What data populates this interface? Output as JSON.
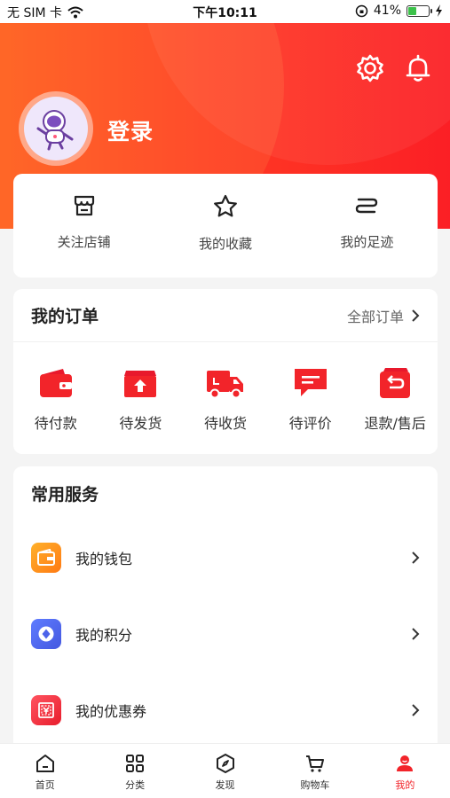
{
  "status_bar": {
    "carrier": "无 SIM 卡",
    "time": "下午10:11",
    "battery": "41%",
    "battery_level": 0.41
  },
  "header": {
    "login_label": "登录"
  },
  "quick_links": [
    {
      "label": "关注店铺",
      "icon": "store-icon"
    },
    {
      "label": "我的收藏",
      "icon": "star-icon"
    },
    {
      "label": "我的足迹",
      "icon": "footprint-icon"
    }
  ],
  "orders": {
    "title": "我的订单",
    "all_label": "全部订单",
    "items": [
      {
        "label": "待付款",
        "icon": "wallet-icon"
      },
      {
        "label": "待发货",
        "icon": "box-icon"
      },
      {
        "label": "待收货",
        "icon": "truck-icon"
      },
      {
        "label": "待评价",
        "icon": "comment-icon"
      },
      {
        "label": "退款/售后",
        "icon": "refund-icon"
      }
    ]
  },
  "services": {
    "title": "常用服务",
    "items": [
      {
        "label": "我的钱包",
        "icon": "wallet-icon"
      },
      {
        "label": "我的积分",
        "icon": "points-icon"
      },
      {
        "label": "我的优惠券",
        "icon": "coupon-icon"
      }
    ]
  },
  "tabbar": [
    {
      "label": "首页",
      "icon": "home-icon"
    },
    {
      "label": "分类",
      "icon": "grid-icon"
    },
    {
      "label": "发现",
      "icon": "compass-icon"
    },
    {
      "label": "购物车",
      "icon": "cart-icon"
    },
    {
      "label": "我的",
      "icon": "profile-icon",
      "active": true
    }
  ],
  "colors": {
    "accent": "#f2242a",
    "header_start": "#ff5a1f",
    "header_end": "#fb1f25"
  }
}
